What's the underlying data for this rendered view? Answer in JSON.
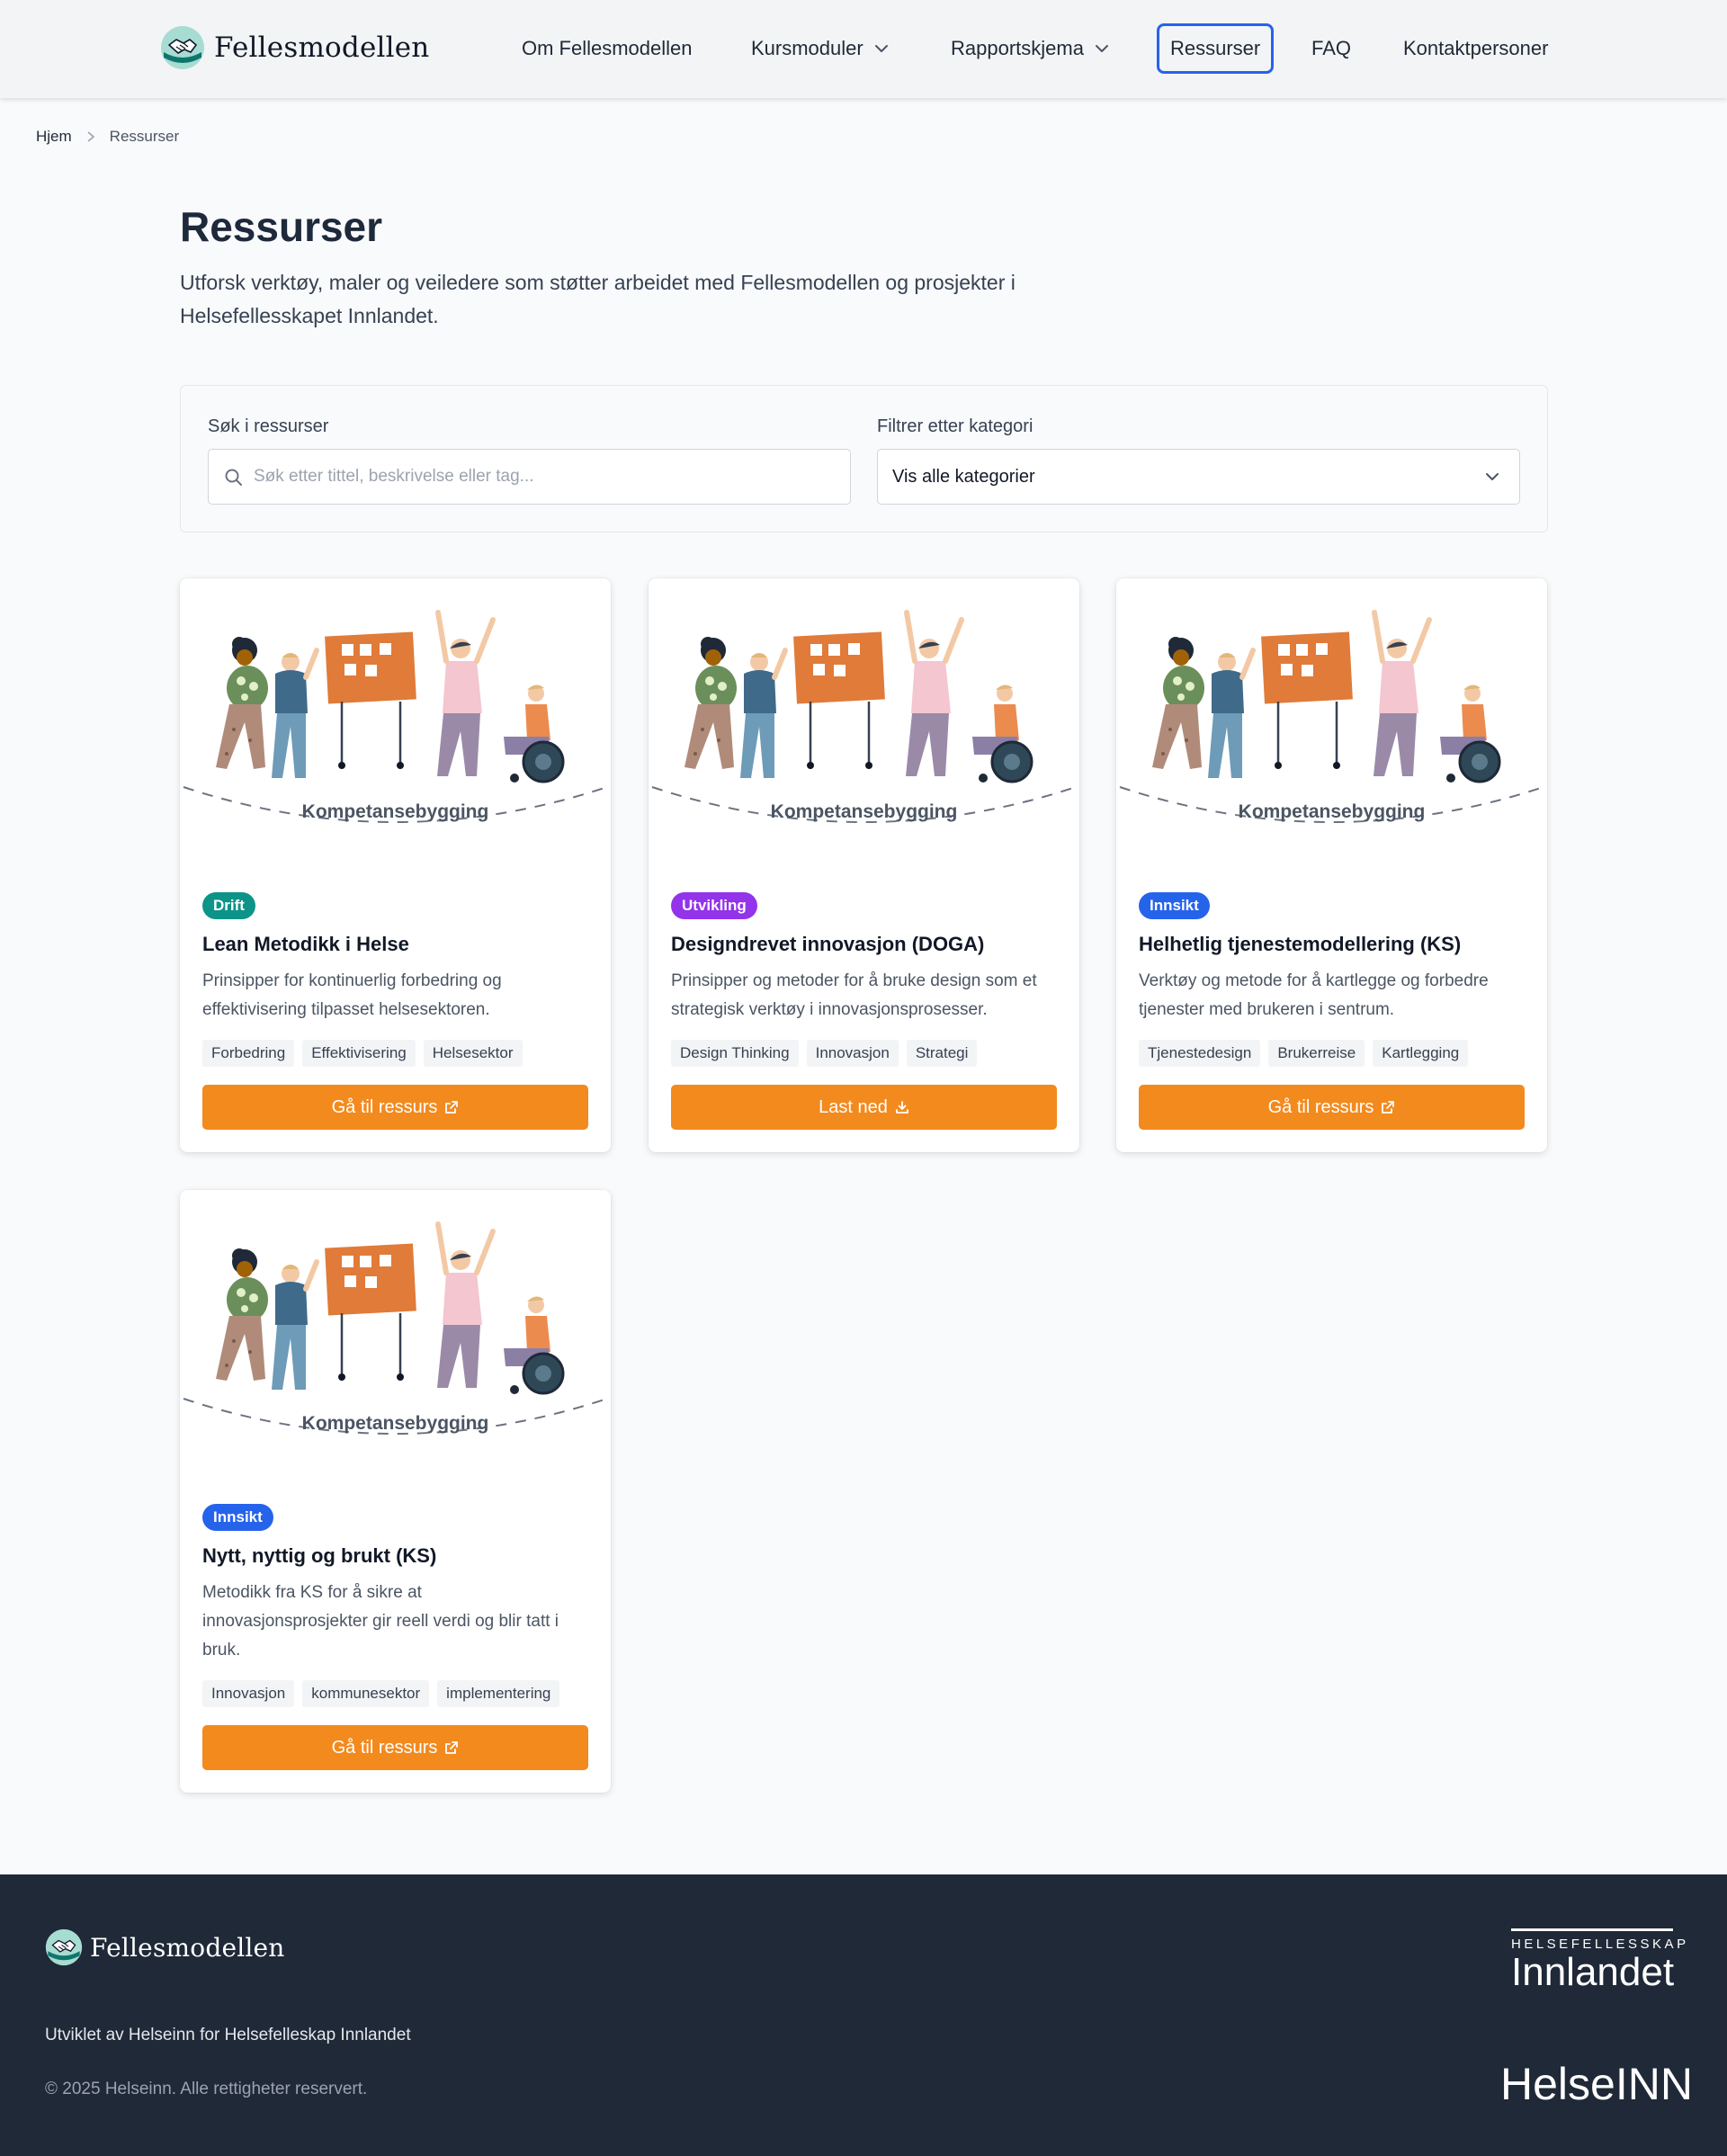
{
  "header": {
    "brand": "Fellesmodellen",
    "nav": [
      {
        "label": "Om Fellesmodellen"
      },
      {
        "label": "Kursmoduler"
      },
      {
        "label": "Rapportskjema"
      },
      {
        "label": "Ressurser"
      },
      {
        "label": "FAQ"
      },
      {
        "label": "Kontaktpersoner"
      }
    ]
  },
  "breadcrumb": {
    "home": "Hjem",
    "current": "Ressurser"
  },
  "page": {
    "title": "Ressurser",
    "intro": "Utforsk verktøy, maler og veiledere som støtter arbeidet med Fellesmodellen og prosjekter i Helsefellesskapet Innlandet."
  },
  "filters": {
    "search_label": "Søk i ressurser",
    "search_placeholder": "Søk etter tittel, beskrivelse eller tag...",
    "search_value": "",
    "category_label": "Filtrer etter kategori",
    "category_value": "Vis alle kategorier"
  },
  "colors": {
    "accent": "#f38a1e",
    "drift": "#0d9488",
    "utvikling": "#9333ea",
    "innsikt": "#2563eb",
    "footer": "#1f2937"
  },
  "cards": [
    {
      "image_caption": "Kompetansebygging",
      "badge": "Drift",
      "title": "Lean Metodikk i Helse",
      "description": "Prinsipper for kontinuerlig forbedring og effektivisering tilpasset helsesektoren.",
      "tags": [
        "Forbedring",
        "Effektivisering",
        "Helsesektor"
      ],
      "button": "Gå til ressurs",
      "button_icon": "external-link-icon"
    },
    {
      "image_caption": "Kompetansebygging",
      "badge": "Utvikling",
      "title": "Designdrevet innovasjon (DOGA)",
      "description": "Prinsipper og metoder for å bruke design som et strategisk verktøy i innovasjonsprosesser.",
      "tags": [
        "Design Thinking",
        "Innovasjon",
        "Strategi"
      ],
      "button": "Last ned",
      "button_icon": "download-icon"
    },
    {
      "image_caption": "Kompetansebygging",
      "badge": "Innsikt",
      "title": "Helhetlig tjenestemodellering (KS)",
      "description": "Verktøy og metode for å kartlegge og forbedre tjenester med brukeren i sentrum.",
      "tags": [
        "Tjenestedesign",
        "Brukerreise",
        "Kartlegging"
      ],
      "button": "Gå til ressurs",
      "button_icon": "external-link-icon"
    },
    {
      "image_caption": "Kompetansebygging",
      "badge": "Innsikt",
      "title": "Nytt, nyttig og brukt (KS)",
      "description": "Metodikk fra KS for å sikre at innovasjonsprosjekter gir reell verdi og blir tatt i bruk.",
      "tags": [
        "Innovasjon",
        "kommunesektor",
        "implementering"
      ],
      "button": "Gå til ressurs",
      "button_icon": "external-link-icon"
    }
  ],
  "footer": {
    "brand": "Fellesmodellen",
    "developed_by": "Utviklet av Helseinn for Helsefelleskap Innlandet",
    "copyright": "© 2025 Helseinn. Alle rettigheter reservert.",
    "partner1_small": "HELSEFELLESSKAP",
    "partner1_big": "Innlandet",
    "partner2": "HelseINN"
  }
}
